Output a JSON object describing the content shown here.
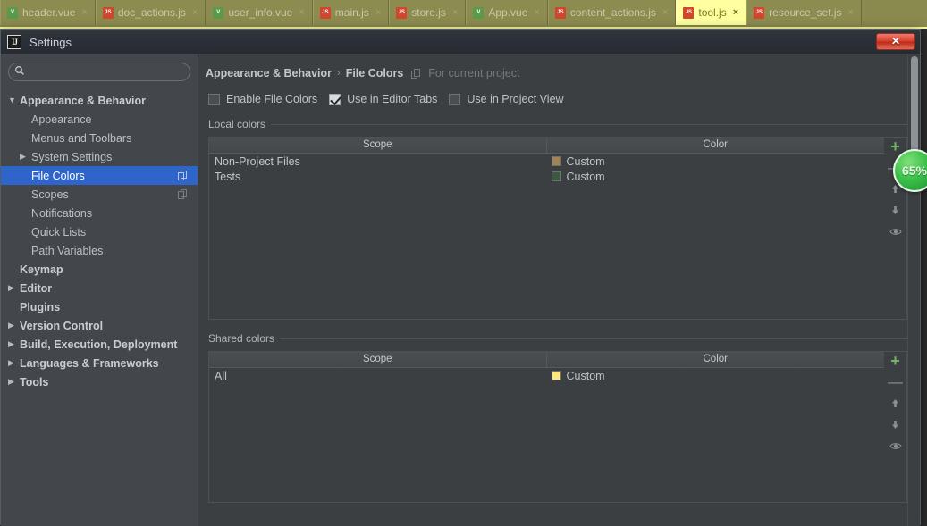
{
  "editor_tabs": [
    {
      "label": "header.vue",
      "icon": "vue-file-icon",
      "kind": "vue",
      "active": false,
      "close": "×"
    },
    {
      "label": "doc_actions.js",
      "icon": "js-file-icon",
      "kind": "js",
      "active": false,
      "close": "×"
    },
    {
      "label": "user_info.vue",
      "icon": "vue-file-icon",
      "kind": "vue",
      "active": false,
      "close": "×"
    },
    {
      "label": "main.js",
      "icon": "js-file-icon",
      "kind": "js",
      "active": false,
      "close": "×"
    },
    {
      "label": "store.js",
      "icon": "js-file-icon",
      "kind": "js",
      "active": false,
      "close": "×"
    },
    {
      "label": "App.vue",
      "icon": "vue-file-icon",
      "kind": "vue",
      "active": false,
      "close": "×"
    },
    {
      "label": "content_actions.js",
      "icon": "js-file-icon",
      "kind": "js",
      "active": false,
      "close": "×"
    },
    {
      "label": "tool.js",
      "icon": "js-file-icon",
      "kind": "js",
      "active": true,
      "close": "×"
    },
    {
      "label": "resource_set.js",
      "icon": "js-file-icon",
      "kind": "js",
      "active": false,
      "close": "×"
    }
  ],
  "dialog": {
    "title": "Settings",
    "logo_text": "IJ",
    "close_label": "✕"
  },
  "sidebar": {
    "search": {
      "value": "",
      "placeholder": "",
      "icon": "search-icon"
    },
    "items": [
      {
        "label": "Appearance & Behavior",
        "twisty": "▼",
        "indent": 0,
        "bold": true,
        "selected": false,
        "badge": ""
      },
      {
        "label": "Appearance",
        "twisty": "",
        "indent": 1,
        "bold": false,
        "selected": false,
        "badge": ""
      },
      {
        "label": "Menus and Toolbars",
        "twisty": "",
        "indent": 1,
        "bold": false,
        "selected": false,
        "badge": ""
      },
      {
        "label": "System Settings",
        "twisty": "▶",
        "indent": 1,
        "bold": false,
        "selected": false,
        "badge": ""
      },
      {
        "label": "File Colors",
        "twisty": "",
        "indent": 1,
        "bold": false,
        "selected": true,
        "badge": "copy-icon"
      },
      {
        "label": "Scopes",
        "twisty": "",
        "indent": 1,
        "bold": false,
        "selected": false,
        "badge": "copy-icon"
      },
      {
        "label": "Notifications",
        "twisty": "",
        "indent": 1,
        "bold": false,
        "selected": false,
        "badge": ""
      },
      {
        "label": "Quick Lists",
        "twisty": "",
        "indent": 1,
        "bold": false,
        "selected": false,
        "badge": ""
      },
      {
        "label": "Path Variables",
        "twisty": "",
        "indent": 1,
        "bold": false,
        "selected": false,
        "badge": ""
      },
      {
        "label": "Keymap",
        "twisty": "",
        "indent": 0,
        "bold": true,
        "selected": false,
        "badge": ""
      },
      {
        "label": "Editor",
        "twisty": "▶",
        "indent": 0,
        "bold": true,
        "selected": false,
        "badge": ""
      },
      {
        "label": "Plugins",
        "twisty": "",
        "indent": 0,
        "bold": true,
        "selected": false,
        "badge": ""
      },
      {
        "label": "Version Control",
        "twisty": "▶",
        "indent": 0,
        "bold": true,
        "selected": false,
        "badge": ""
      },
      {
        "label": "Build, Execution, Deployment",
        "twisty": "▶",
        "indent": 0,
        "bold": true,
        "selected": false,
        "badge": ""
      },
      {
        "label": "Languages & Frameworks",
        "twisty": "▶",
        "indent": 0,
        "bold": true,
        "selected": false,
        "badge": ""
      },
      {
        "label": "Tools",
        "twisty": "▶",
        "indent": 0,
        "bold": true,
        "selected": false,
        "badge": ""
      }
    ]
  },
  "content": {
    "breadcrumb": {
      "parent": "Appearance & Behavior",
      "separator": "›",
      "current": "File Colors",
      "note": "For current project",
      "note_icon": "copy-icon"
    },
    "checkboxes": [
      {
        "label": "Enable File Colors",
        "mnemonic": "F",
        "checked": false
      },
      {
        "label": "Use in Editor Tabs",
        "mnemonic": "t",
        "checked": true
      },
      {
        "label": "Use in Project View",
        "mnemonic": "P",
        "checked": false
      }
    ],
    "local_section": {
      "title": "Local colors",
      "columns": [
        "Scope",
        "Color"
      ],
      "rows": [
        {
          "scope": "Non-Project Files",
          "color_label": "Custom",
          "color_hex": "#a08458"
        },
        {
          "scope": "Tests",
          "color_label": "Custom",
          "color_hex": "#3d5a3c"
        }
      ],
      "toolbar": [
        {
          "name": "add-button",
          "glyph": "+",
          "kind": "plus"
        },
        {
          "name": "remove-button",
          "glyph": "—",
          "kind": "minus"
        },
        {
          "name": "move-up-button",
          "glyph": "⬆",
          "kind": "arrow"
        },
        {
          "name": "move-down-button",
          "glyph": "⬇",
          "kind": "arrow"
        },
        {
          "name": "share-eye-button",
          "glyph": "◉",
          "kind": "eye"
        }
      ]
    },
    "shared_section": {
      "title": "Shared colors",
      "columns": [
        "Scope",
        "Color"
      ],
      "rows": [
        {
          "scope": "All",
          "color_label": "Custom",
          "color_hex": "#ffe680"
        }
      ],
      "toolbar": [
        {
          "name": "add-button",
          "glyph": "+",
          "kind": "plus"
        },
        {
          "name": "remove-button",
          "glyph": "—",
          "kind": "minus"
        },
        {
          "name": "move-up-button",
          "glyph": "⬆",
          "kind": "arrow"
        },
        {
          "name": "move-down-button",
          "glyph": "⬇",
          "kind": "arrow"
        },
        {
          "name": "unshare-eye-button",
          "glyph": "◉",
          "kind": "eye"
        }
      ]
    }
  },
  "overlay": {
    "zoom_badge": "65%"
  },
  "colors": {
    "selection_blue": "#2f65ca",
    "dialog_bg": "#3c3f41",
    "sidebar_bg": "#43474c",
    "tabbar_olive": "#8a8a4e",
    "active_tab_yellow": "#ffffa0",
    "close_red": "#d9402c",
    "badge_green": "#39bf48"
  }
}
